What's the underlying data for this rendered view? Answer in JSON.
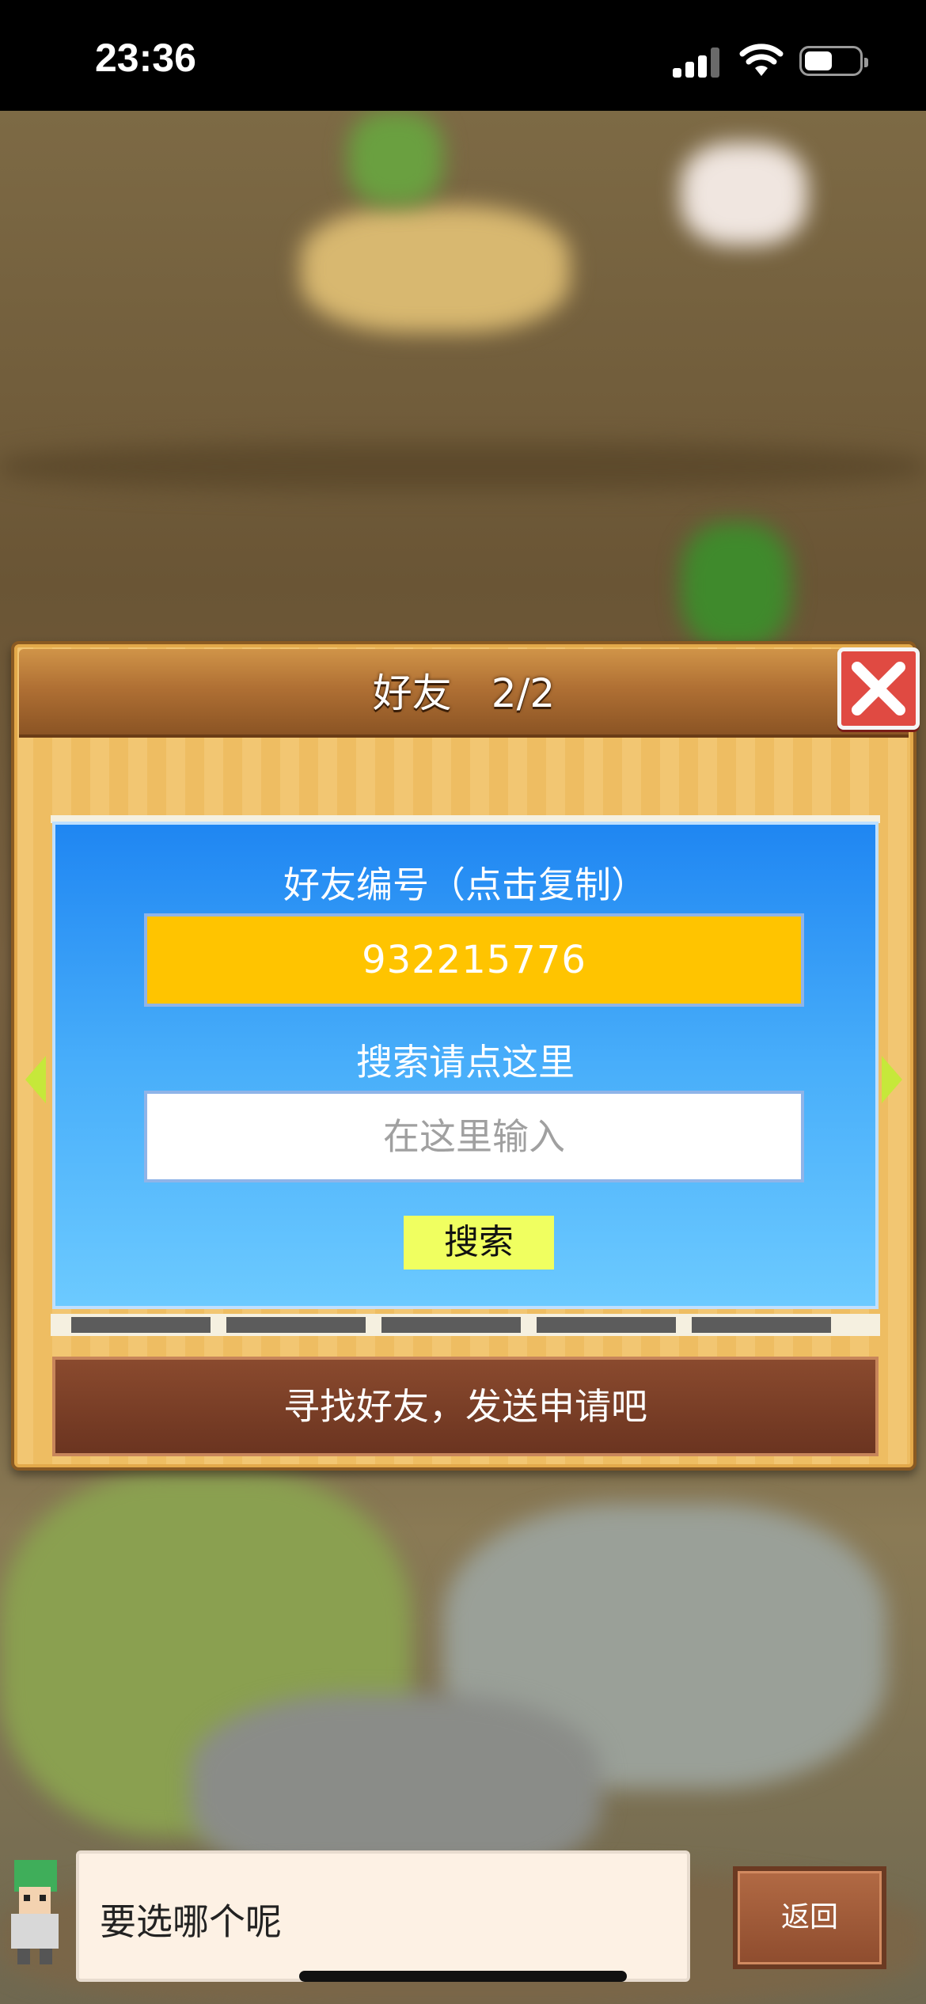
{
  "status_bar": {
    "time": "23:36"
  },
  "dialog": {
    "title": "好友　2/2",
    "friend_id_label": "好友编号（点击复制）",
    "friend_id_value": "932215776",
    "search_label": "搜索请点这里",
    "search_placeholder": "在这里输入",
    "search_button": "搜索",
    "find_friends_button": "寻找好友，发送申请吧"
  },
  "bottom_bar": {
    "message": "要选哪个呢",
    "back_button": "返回"
  },
  "colors": {
    "panel_blue": "#1f86f2",
    "id_box_yellow": "#ffc400",
    "search_button_yellow": "#f0ff60",
    "close_red": "#e04a42",
    "find_button_brown": "#7a3e26"
  },
  "icons": [
    "signal-icon",
    "wifi-icon",
    "battery-icon",
    "close-icon",
    "arrow-left-icon",
    "arrow-right-icon",
    "character-avatar"
  ]
}
